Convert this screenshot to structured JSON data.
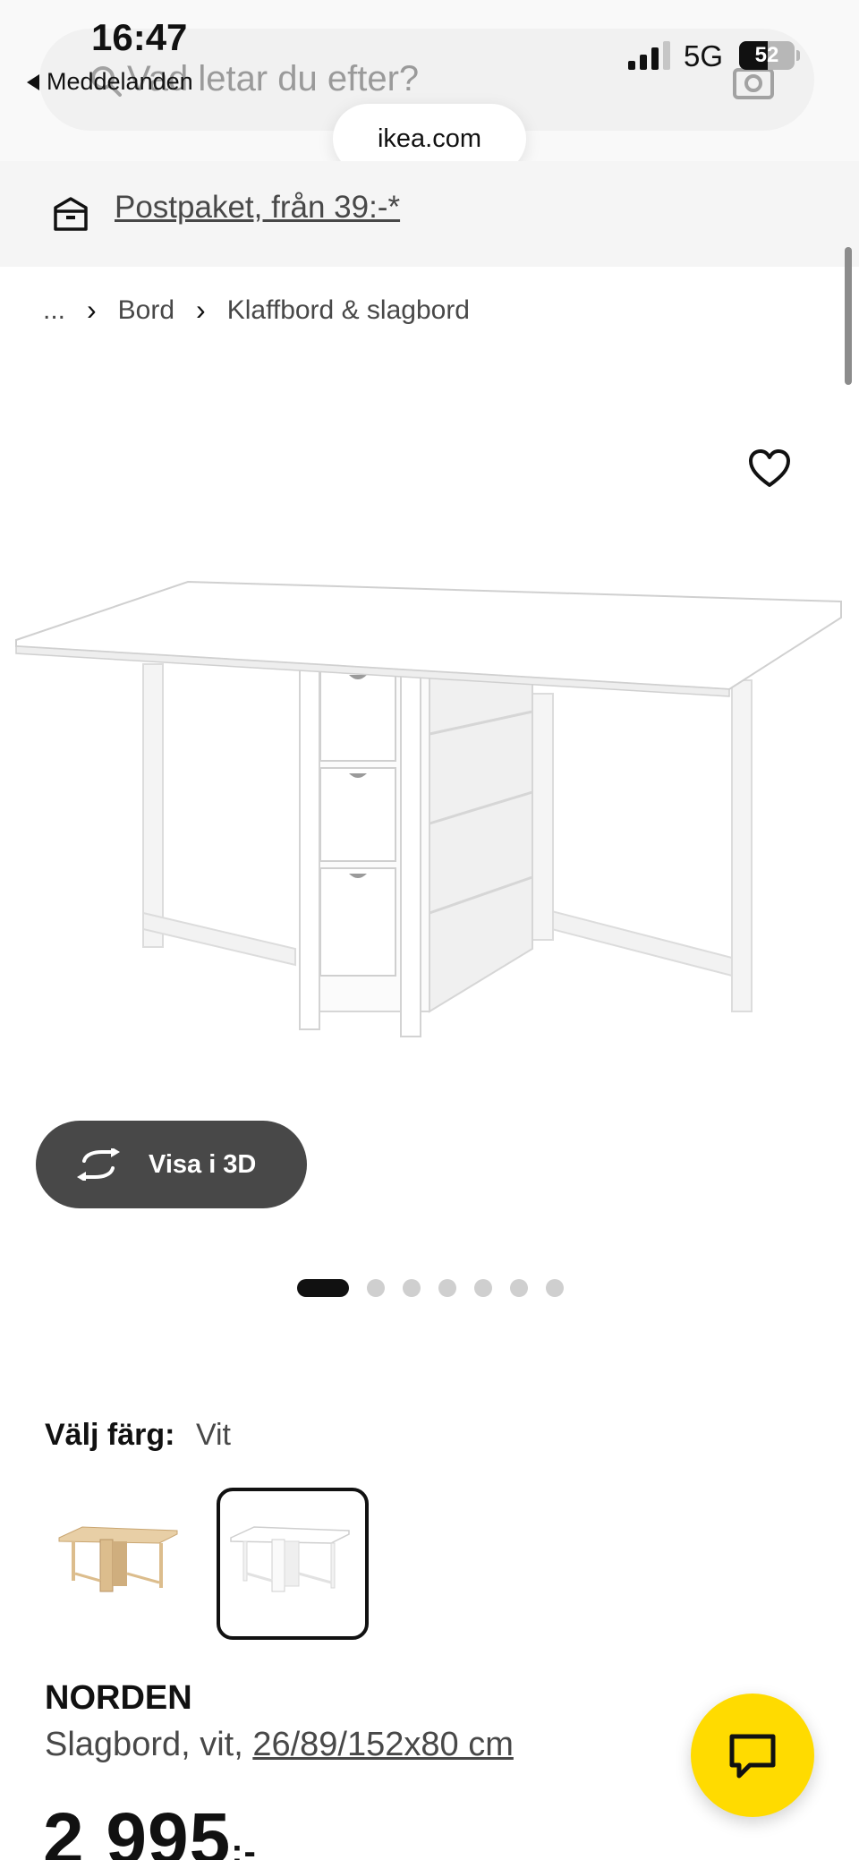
{
  "status_bar": {
    "time": "16:47",
    "back_label": "Meddelanden",
    "network": "5G",
    "battery_percent": 52,
    "battery_label": "52"
  },
  "search": {
    "placeholder": "Vad letar du efter?"
  },
  "browser": {
    "url": "ikea.com"
  },
  "delivery_banner": {
    "text": "Postpaket, från 39:-*"
  },
  "breadcrumb": {
    "items": [
      "...",
      "Bord",
      "Klaffbord & slagbord"
    ]
  },
  "gallery": {
    "view_3d_label": "Visa i 3D",
    "image_count": 7,
    "active_index": 0
  },
  "color_selection": {
    "label": "Välj färg:",
    "selected": "Vit",
    "swatches": [
      "björk",
      "vit"
    ]
  },
  "product": {
    "name": "NORDEN",
    "description": "Slagbord, vit, ",
    "dimensions": "26/89/152x80 cm",
    "price": "2 995",
    "price_suffix": ":-"
  },
  "colors": {
    "accent_yellow": "#ffdb00",
    "dark_button": "#484848",
    "text_primary": "#111111",
    "text_secondary": "#484848"
  },
  "icons": {
    "search": "search-icon",
    "camera": "camera-icon",
    "delivery": "box-icon",
    "favorite": "heart-icon",
    "rotate": "rotate-3d-icon",
    "chat": "chat-icon"
  }
}
